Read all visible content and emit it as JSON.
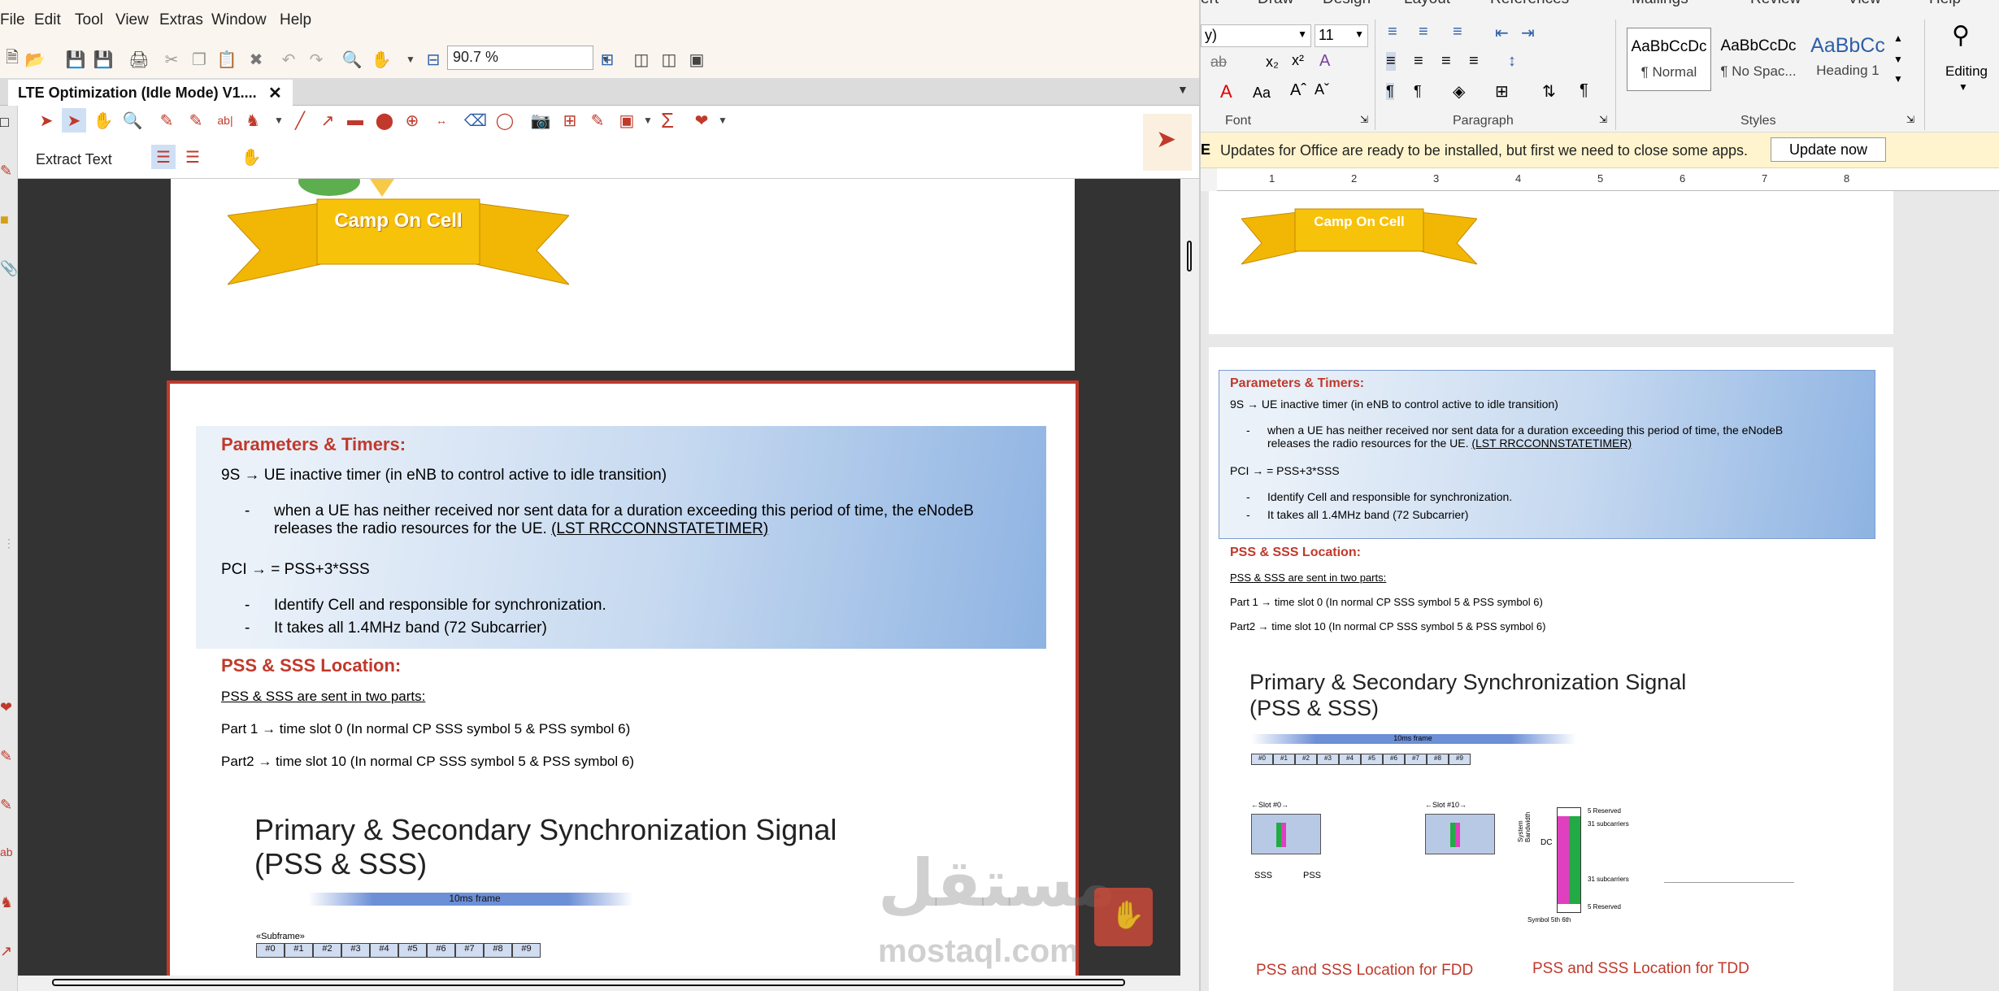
{
  "pdf": {
    "menu": [
      "File",
      "Edit",
      "Tool",
      "View",
      "Extras",
      "Window",
      "Help"
    ],
    "zoom": "90.7 %",
    "tab_title": "LTE Optimization (Idle Mode) V1....",
    "extract_text": "Extract Text",
    "banner": "Camp On Cell",
    "heading1": "Parameters & Timers:",
    "line1": "9S → UE inactive timer (in eNB to control active to idle transition)",
    "bullet1a": "when a UE has neither received nor sent data for a duration exceeding this period of time, the eNodeB",
    "bullet1b": "releases the radio resources for the UE. ",
    "bullet1c": "(LST RRCCONNSTATETIMER)",
    "line2": "PCI → = PSS+3*SSS",
    "bullet2": "Identify Cell and responsible for synchronization.",
    "bullet3": "It takes all 1.4MHz band (72 Subcarrier)",
    "heading2": "PSS & SSS Location:",
    "line3": "PSS & SSS are sent in two parts:",
    "line4": "Part 1 → time slot 0 (In normal CP SSS symbol 5 & PSS symbol 6)",
    "line5": "Part2 → time slot 10 (In normal CP SSS symbol 5 & PSS symbol 6)",
    "slide_title1": "Primary & Secondary Synchronization Signal",
    "slide_title2": "(PSS & SSS)",
    "frame_label": "10ms frame",
    "subframe_label": "«Subframe»",
    "subframes": [
      "#0",
      "#1",
      "#2",
      "#3",
      "#4",
      "#5",
      "#6",
      "#7",
      "#8",
      "#9"
    ],
    "watermark1": "مستقل",
    "watermark2": "mostaql.com"
  },
  "word": {
    "tabs": [
      "ert",
      "Draw",
      "Design",
      "Layout",
      "References",
      "Mailings",
      "Review",
      "View",
      "Help"
    ],
    "font_name": "y)",
    "font_size": "11",
    "styles": [
      {
        "sample": "AaBbCcDc",
        "name": "¶ Normal"
      },
      {
        "sample": "AaBbCcDc",
        "name": "¶ No Spac..."
      },
      {
        "sample": "AaBbCc",
        "name": "Heading 1"
      }
    ],
    "groups": [
      "Font",
      "Paragraph",
      "Styles"
    ],
    "editing": "Editing",
    "notif_prefix": "E",
    "notif_text": "Updates for Office are ready to be installed, but first we need to close some apps.",
    "update_btn": "Update now",
    "ruler_nums": [
      "1",
      "2",
      "3",
      "4",
      "5",
      "6",
      "7",
      "8"
    ],
    "banner": "Camp On Cell",
    "heading1": "Parameters & Timers:",
    "line1": "9S → UE inactive timer (in eNB to control active to idle transition)",
    "bullet1a": "when a UE has neither received nor sent data for a duration exceeding this period of time, the eNodeB",
    "bullet1b": "releases the radio resources for the UE. ",
    "bullet1c": "(LST RRCCONNSTATETIMER)",
    "line2": "PCI → = PSS+3*SSS",
    "bullet2": "Identify Cell and responsible for synchronization.",
    "bullet3": "It takes all 1.4MHz band (72 Subcarrier)",
    "heading2": "PSS & SSS Location:",
    "line3": "PSS & SSS are sent in two parts:",
    "line4": "Part 1 → time slot 0 (In normal CP SSS symbol 5 & PSS symbol 6)",
    "line5": "Part2 → time slot 10 (In normal CP SSS symbol 5 & PSS symbol 6)",
    "slide_title1": "Primary & Secondary Synchronization Signal",
    "slide_title2": "(PSS & SSS)",
    "frame_label": "10ms frame",
    "slot0": "←Slot #0→",
    "slot10": "←Slot #10→",
    "sss": "SSS",
    "pss": "PSS",
    "sysbw": "System Bandwidth",
    "dc": "DC",
    "reserved_top": "5 Reserved",
    "sub31a": "31 subcarriers",
    "sub31b": "31 subcarriers",
    "reserved_bot": "5 Reserved",
    "symbol": "Symbol 5th 6th",
    "fdd": "PSS and SSS Location for FDD",
    "tdd": "PSS and SSS Location for TDD"
  }
}
